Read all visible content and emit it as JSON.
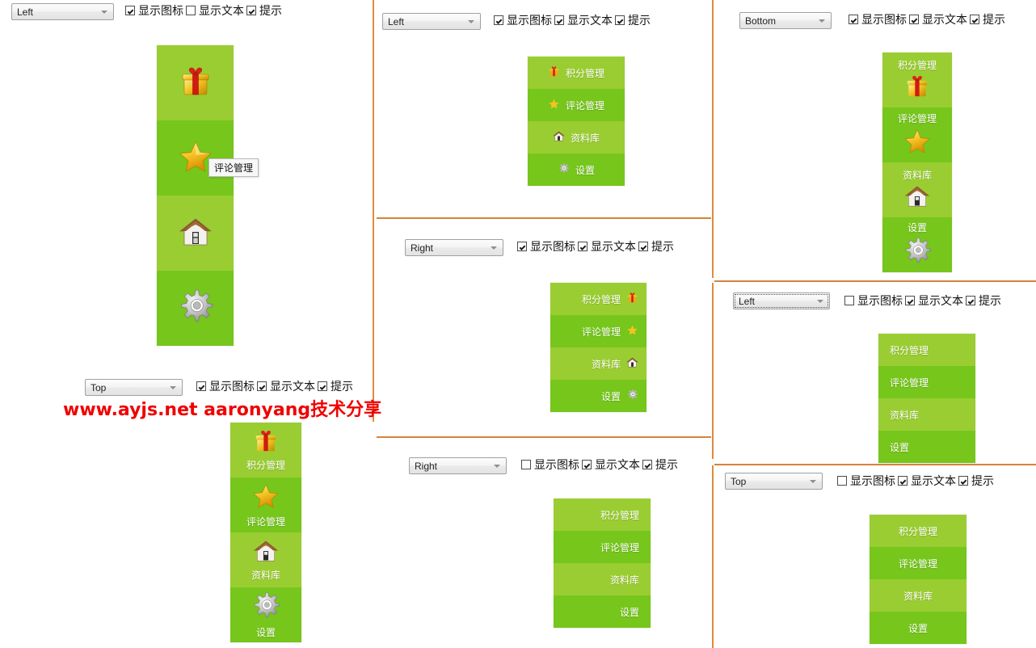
{
  "labels": {
    "show_icon": "显示图标",
    "show_text": "显示文本",
    "tooltip": "提示"
  },
  "menu_items": [
    {
      "label": "积分管理",
      "icon": "gift-icon"
    },
    {
      "label": "评论管理",
      "icon": "star-icon"
    },
    {
      "label": "资料库",
      "icon": "house-icon"
    },
    {
      "label": "设置",
      "icon": "gear-icon"
    }
  ],
  "colors": {
    "item_light": "#9acd32",
    "item_dark": "#76c61c",
    "divider_orange": "#e08b3e",
    "watermark_red": "#f00000",
    "menu_text": "#ffffff"
  },
  "panels": [
    {
      "id": "panel-1",
      "dropdown_value": "Left",
      "dropdown_focused": false,
      "show_icon": true,
      "show_text": false,
      "show_tooltip": true,
      "tooltip_text": "评论管理"
    },
    {
      "id": "panel-2",
      "dropdown_value": "Left",
      "dropdown_focused": false,
      "show_icon": true,
      "show_text": true,
      "show_tooltip": true
    },
    {
      "id": "panel-3",
      "dropdown_value": "Bottom",
      "dropdown_focused": false,
      "show_icon": true,
      "show_text": true,
      "show_tooltip": true
    },
    {
      "id": "panel-4",
      "dropdown_value": "Right",
      "dropdown_focused": false,
      "show_icon": true,
      "show_text": true,
      "show_tooltip": true
    },
    {
      "id": "panel-5",
      "dropdown_value": "Top",
      "dropdown_focused": false,
      "show_icon": true,
      "show_text": true,
      "show_tooltip": true
    },
    {
      "id": "panel-6",
      "dropdown_value": "Left",
      "dropdown_focused": true,
      "show_icon": false,
      "show_text": true,
      "show_tooltip": true
    },
    {
      "id": "panel-7",
      "dropdown_value": "Right",
      "dropdown_focused": false,
      "show_icon": false,
      "show_text": true,
      "show_tooltip": true
    },
    {
      "id": "panel-8",
      "dropdown_value": "Top",
      "dropdown_focused": false,
      "show_icon": false,
      "show_text": true,
      "show_tooltip": true
    }
  ],
  "watermark": "www.ayjs.net  aaronyang技术分享"
}
